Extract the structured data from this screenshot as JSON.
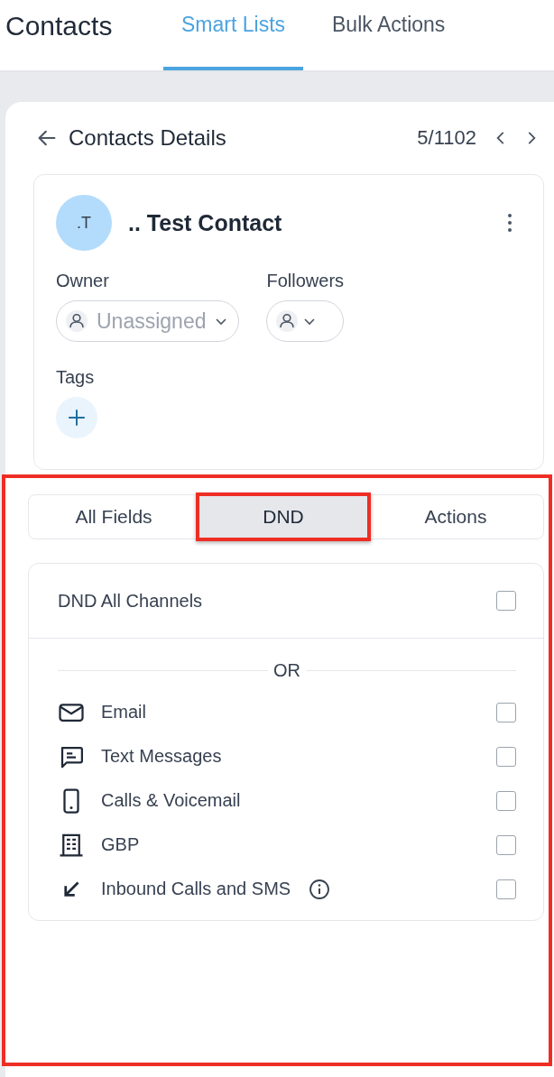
{
  "header": {
    "title": "Contacts",
    "tabs": [
      {
        "label": "Smart Lists",
        "selected": true
      },
      {
        "label": "Bulk Actions",
        "selected": false
      }
    ]
  },
  "details": {
    "title": "Contacts Details",
    "position": "5/1102"
  },
  "contact": {
    "initials": ".T",
    "name": ".. Test Contact",
    "owner_label": "Owner",
    "owner_value": "Unassigned",
    "followers_label": "Followers",
    "tags_label": "Tags"
  },
  "panel_tabs": [
    {
      "label": "All Fields",
      "selected": false
    },
    {
      "label": "DND",
      "selected": true
    },
    {
      "label": "Actions",
      "selected": false
    }
  ],
  "dnd": {
    "all_channels": {
      "label": "DND All Channels",
      "checked": false
    },
    "separator": "OR",
    "channels": [
      {
        "kind": "email",
        "label": "Email",
        "checked": false
      },
      {
        "kind": "text",
        "label": "Text Messages",
        "checked": false
      },
      {
        "kind": "phone",
        "label": "Calls & Voicemail",
        "checked": false
      },
      {
        "kind": "building",
        "label": "GBP",
        "checked": false
      },
      {
        "kind": "inbound",
        "label": "Inbound Calls and SMS",
        "info": true,
        "checked": false
      }
    ]
  }
}
